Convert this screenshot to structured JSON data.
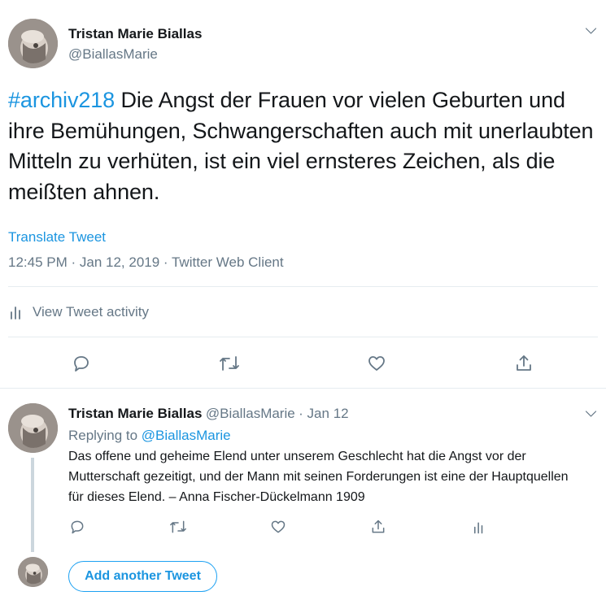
{
  "main_tweet": {
    "author_name": "Tristan Marie Biallas",
    "author_handle": "@BiallasMarie",
    "hashtag": "#archiv218",
    "text": " Die Angst der Frauen vor vielen Geburten und ihre Bemühungen, Schwangerschaften auch mit unerlaubten Mitteln zu verhüten, ist ein viel ernsteres Zeichen, als die meißten ahnen.",
    "translate_label": "Translate Tweet",
    "meta": "12:45 PM · Jan 12, 2019 · Twitter Web Client",
    "activity_label": "View Tweet activity"
  },
  "reply_tweet": {
    "author_name": "Tristan Marie Biallas",
    "author_handle": "@BiallasMarie",
    "date": "· Jan 12",
    "replying_to_label": "Replying to",
    "replying_to_handle": "@BiallasMarie",
    "text": "Das offene und geheime Elend unter unserem Geschlecht hat die Angst vor der Mutterschaft gezeitigt, und der Mann mit seinen Forderungen ist eine der Hauptquellen für dieses Elend. – Anna Fischer-Dückelmann 1909"
  },
  "compose": {
    "add_button_label": "Add another Tweet"
  },
  "colors": {
    "link_blue": "#1b95e0",
    "grey_text": "#657786",
    "divider": "#e6ecf0"
  },
  "icons": [
    "chevron-down-icon",
    "analytics-icon",
    "reply-icon",
    "retweet-icon",
    "like-icon",
    "share-icon"
  ]
}
